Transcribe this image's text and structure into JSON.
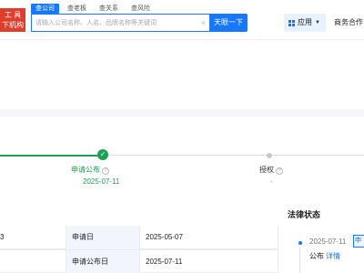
{
  "header": {
    "logo_line1": "工 具",
    "logo_line2": "下机构",
    "search_tabs": [
      "查公司",
      "查老板",
      "查关系",
      "查风险"
    ],
    "search_placeholder": "请输入公司名称、人名、品牌名称等关键词",
    "search_button": "天眼一下",
    "apps_label": "应用",
    "biz_link": "商务合作"
  },
  "timeline": {
    "steps": [
      {
        "title": "申请公布",
        "date": "2025-07-11",
        "status": "done"
      },
      {
        "title": "授权",
        "date": "-",
        "status": "pending"
      }
    ]
  },
  "table": {
    "rows": [
      {
        "left_value": "3",
        "key": "申请日",
        "value": "2025-05-07"
      },
      {
        "left_value": "",
        "key": "申请公布日",
        "value": "2025-07-11"
      }
    ]
  },
  "legal_status": {
    "title": "法律状态",
    "date": "2025-07-11",
    "tag": "申",
    "event": "公布",
    "detail_link": "详情"
  },
  "colors": {
    "accent": "#1677ff",
    "success": "#1e9e55",
    "logo": "#e03e2d"
  }
}
